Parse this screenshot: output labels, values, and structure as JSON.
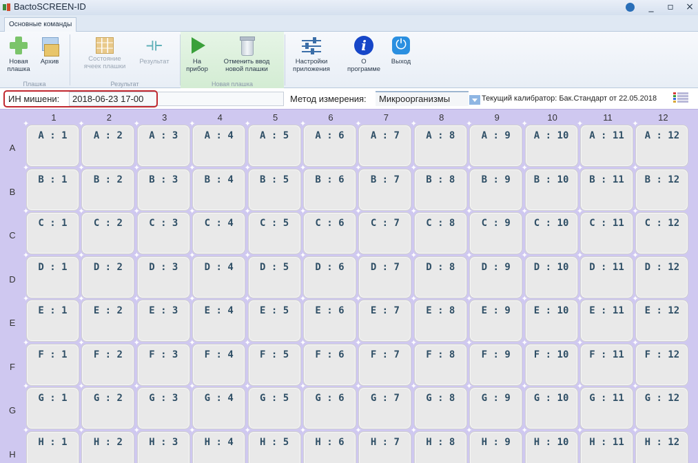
{
  "window": {
    "title": "BactoSCREEN-ID",
    "controls": [
      "_",
      "▫",
      "×"
    ]
  },
  "ribbon": {
    "tab_label": "Основные команды",
    "groups": [
      {
        "label": "Плашка",
        "buttons": [
          {
            "label": "Новая\nплашка",
            "icon": "plus-icon"
          },
          {
            "label": "Архив",
            "icon": "archive-icon"
          }
        ]
      },
      {
        "label": "Результат",
        "buttons": [
          {
            "label": "Состояние\nячеек плашки",
            "icon": "plate-grid-icon"
          },
          {
            "label": "Результат",
            "icon": "result-icon"
          }
        ]
      },
      {
        "label": "Новая плашка",
        "buttons": [
          {
            "label": "На\nприбор",
            "icon": "play-icon"
          },
          {
            "label": "Отменить ввод\nновой плашки",
            "icon": "bin-icon"
          }
        ]
      },
      {
        "label": "",
        "buttons": [
          {
            "label": "Настройки\nприложения",
            "icon": "sliders-icon"
          },
          {
            "label": "О\nпрограмме",
            "icon": "info-icon"
          },
          {
            "label": "Выход",
            "icon": "power-icon"
          }
        ]
      }
    ]
  },
  "info": {
    "target_label": "ИН мишени:",
    "target_value": "2018-06-23 17-00",
    "method_label": "Метод измерения:",
    "method_value": "Микроорганизмы",
    "calibrator": "Текущий калибратор: Бак.Стандарт от 22.05.2018"
  },
  "plate": {
    "columns": [
      "1",
      "2",
      "3",
      "4",
      "5",
      "6",
      "7",
      "8",
      "9",
      "10",
      "11",
      "12"
    ],
    "rows": [
      "A",
      "B",
      "C",
      "D",
      "E",
      "F",
      "G",
      "H"
    ]
  },
  "colors": {
    "plate_bg": "#cfc8f0",
    "well_bg": "#e9e9e9",
    "well_text": "#2f4f66",
    "highlight_border": "#c0262d"
  }
}
